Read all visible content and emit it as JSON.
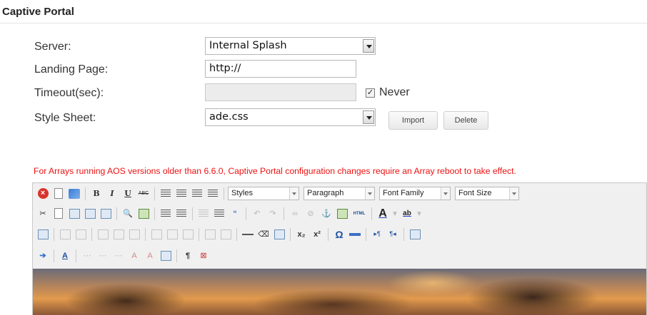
{
  "section": {
    "title": "Captive Portal"
  },
  "form": {
    "server": {
      "label": "Server:",
      "value": "Internal Splash"
    },
    "landing_page": {
      "label": "Landing Page:",
      "value": "http://"
    },
    "timeout": {
      "label": "Timeout(sec):",
      "value": "",
      "never_checked": true,
      "never_label": "Never"
    },
    "style_sheet": {
      "label": "Style Sheet:",
      "value": "ade.css",
      "import_label": "Import",
      "delete_label": "Delete"
    }
  },
  "notice": "For Arrays running AOS versions older than 6.6.0, Captive Portal configuration changes require an Array reboot to take effect.",
  "editor": {
    "row1": {
      "bold": "B",
      "italic": "I",
      "underline": "U",
      "strike": "ABC",
      "styles": "Styles",
      "paragraph": "Paragraph",
      "font_family": "Font Family",
      "font_size": "Font Size"
    },
    "row2": {
      "html": "HTML",
      "font_color": "A",
      "highlight": "ab"
    },
    "row3": {
      "subscript": "x₂",
      "superscript": "x²",
      "omega": "Ω",
      "ltr": "▸¶",
      "rtl": "¶◂"
    },
    "row4": {
      "abbr": "A",
      "pilcrow": "¶"
    }
  },
  "colors": {
    "notice": "#ee1111",
    "border": "#b7b7b7"
  }
}
